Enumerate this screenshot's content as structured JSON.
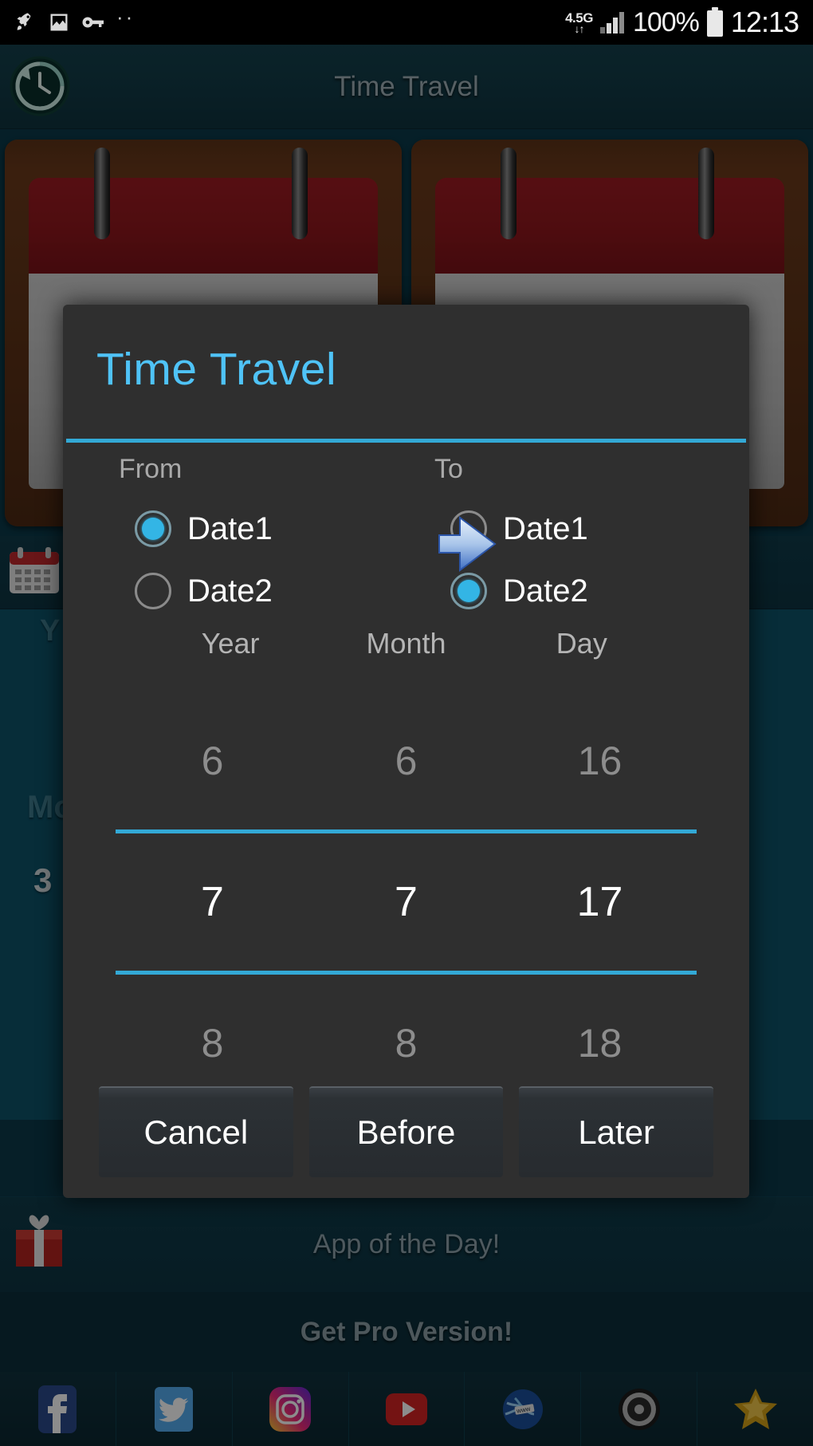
{
  "statusbar": {
    "icons": [
      "rocket-icon",
      "image-icon",
      "key-icon",
      "more-dots-icon"
    ],
    "network_label": "4.5G",
    "network_arrows": "↓↑",
    "battery_percent": "100%",
    "time": "12:13"
  },
  "appbar": {
    "title": "Time Travel",
    "icon": "history-clock-icon"
  },
  "background": {
    "calendar_cards": [
      "calendar-card-1",
      "calendar-card-2"
    ],
    "row_calendar_icon": "calendar-icon",
    "partial_labels": {
      "year": "Y",
      "month": "Mo",
      "month_value": "3"
    },
    "app_of_the_day": "App of the Day!",
    "app_of_the_day_icon": "gift-icon",
    "get_pro": "Get Pro Version!"
  },
  "dialog": {
    "title": "Time Travel",
    "accent_color": "#33a9d6",
    "title_color": "#4fc3f7",
    "from": {
      "label": "From",
      "options": [
        {
          "label": "Date1",
          "selected": true
        },
        {
          "label": "Date2",
          "selected": false
        }
      ]
    },
    "to": {
      "label": "To",
      "options": [
        {
          "label": "Date1",
          "selected": false
        },
        {
          "label": "Date2",
          "selected": true
        }
      ]
    },
    "arrow_icon": "right-arrow-icon",
    "columns": [
      "Year",
      "Month",
      "Day"
    ],
    "picker": {
      "above": {
        "year": "6",
        "month": "6",
        "day": "16"
      },
      "selected": {
        "year": "7",
        "month": "7",
        "day": "17"
      },
      "below": {
        "year": "8",
        "month": "8",
        "day": "18"
      }
    },
    "buttons": {
      "cancel": "Cancel",
      "before": "Before",
      "later": "Later"
    }
  },
  "social_bar": [
    {
      "name": "facebook-icon"
    },
    {
      "name": "twitter-icon"
    },
    {
      "name": "instagram-icon"
    },
    {
      "name": "youtube-icon"
    },
    {
      "name": "web-globe-icon"
    },
    {
      "name": "settings-gear-icon"
    },
    {
      "name": "rate-star-icon"
    }
  ]
}
